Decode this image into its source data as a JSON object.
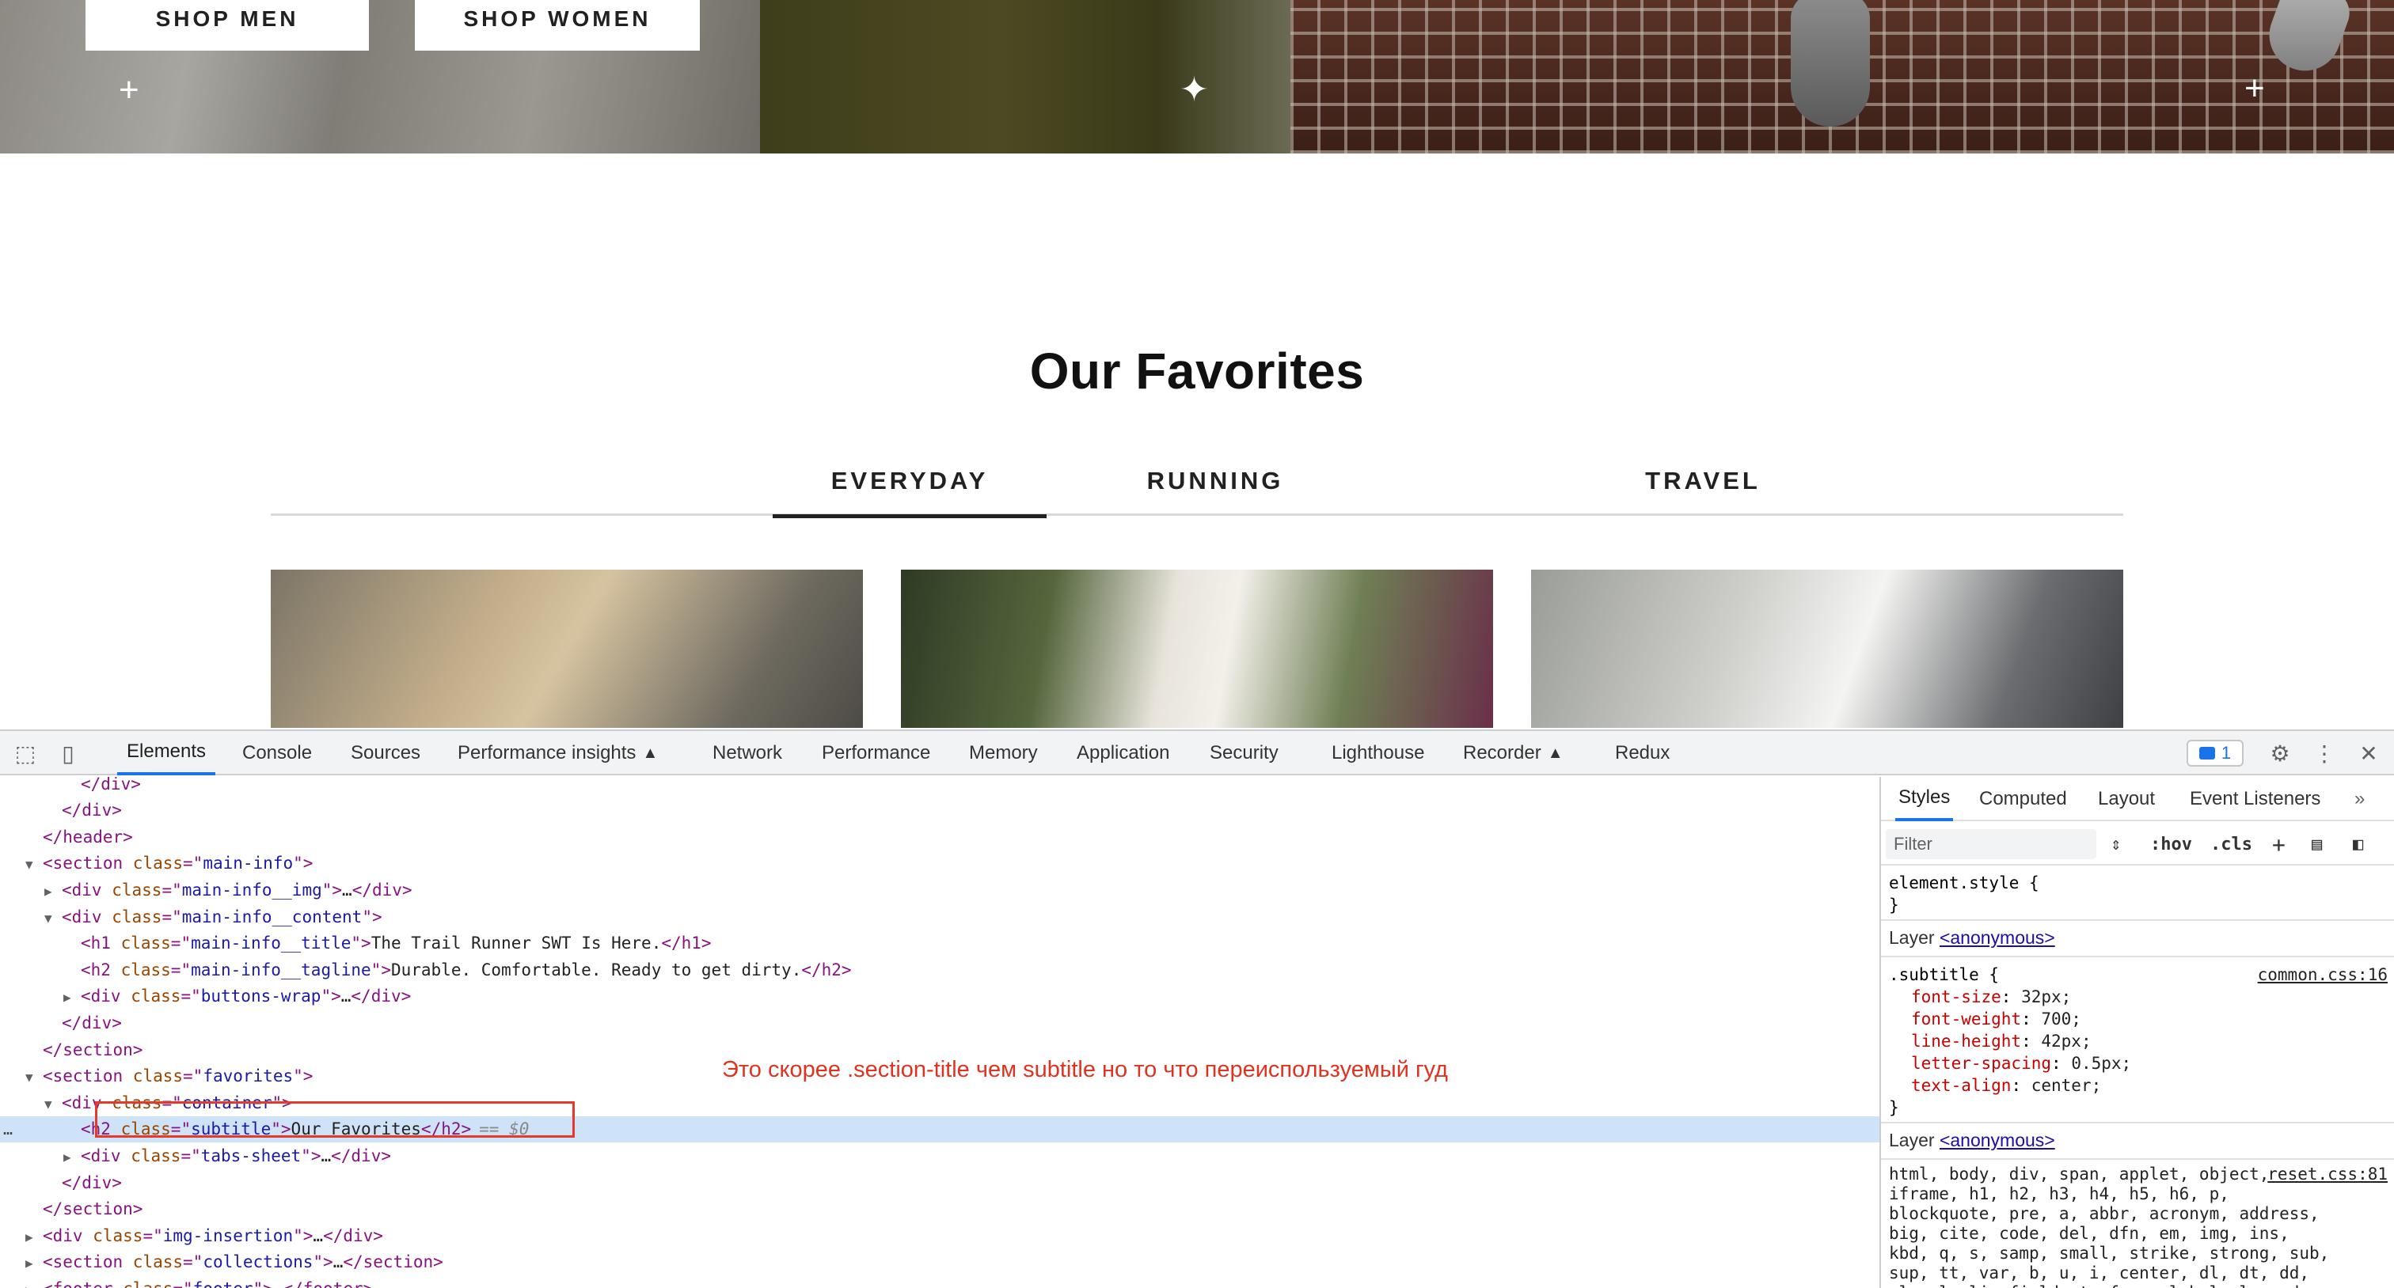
{
  "site": {
    "hero": {
      "shop_men": "SHOP MEN",
      "shop_women": "SHOP WOMEN"
    },
    "favorites": {
      "title": "Our Favorites",
      "tabs": [
        "EVERYDAY",
        "RUNNING",
        "TRAVEL"
      ],
      "active_tab": "EVERYDAY"
    }
  },
  "devtools": {
    "tabs": [
      "Elements",
      "Console",
      "Sources",
      "Performance insights",
      "Network",
      "Performance",
      "Memory",
      "Application",
      "Security",
      "Lighthouse",
      "Recorder",
      "Redux"
    ],
    "active_tab": "Elements",
    "issues_count": "1",
    "dom_lines": [
      {
        "indent": 0,
        "arrow": "",
        "parts": [
          [
            "tag",
            "</div>"
          ]
        ]
      },
      {
        "indent": 0,
        "arrow": "",
        "parts": [
          [
            "tag",
            "</div>"
          ]
        ]
      },
      {
        "indent": 0,
        "arrow": "",
        "parts": [
          [
            "tag",
            "</header>"
          ]
        ]
      },
      {
        "indent": 0,
        "arrow": "▼",
        "parts": [
          [
            "tag",
            "<section "
          ],
          [
            "attr",
            "class"
          ],
          [
            "tag",
            "=\""
          ],
          [
            "val",
            "main-info"
          ],
          [
            "tag",
            "\">"
          ]
        ]
      },
      {
        "indent": 1,
        "arrow": "▶",
        "parts": [
          [
            "tag",
            "<div "
          ],
          [
            "attr",
            "class"
          ],
          [
            "tag",
            "=\""
          ],
          [
            "val",
            "main-info__img"
          ],
          [
            "tag",
            "\">"
          ],
          [
            "txt",
            "…"
          ],
          [
            "tag",
            "</div>"
          ]
        ]
      },
      {
        "indent": 1,
        "arrow": "▼",
        "parts": [
          [
            "tag",
            "<div "
          ],
          [
            "attr",
            "class"
          ],
          [
            "tag",
            "=\""
          ],
          [
            "val",
            "main-info__content"
          ],
          [
            "tag",
            "\">"
          ]
        ]
      },
      {
        "indent": 2,
        "arrow": "",
        "parts": [
          [
            "tag",
            "<h1 "
          ],
          [
            "attr",
            "class"
          ],
          [
            "tag",
            "=\""
          ],
          [
            "val",
            "main-info__title"
          ],
          [
            "tag",
            "\">"
          ],
          [
            "txt",
            "The Trail Runner SWT Is Here."
          ],
          [
            "tag",
            "</h1>"
          ]
        ]
      },
      {
        "indent": 2,
        "arrow": "",
        "parts": [
          [
            "tag",
            "<h2 "
          ],
          [
            "attr",
            "class"
          ],
          [
            "tag",
            "=\""
          ],
          [
            "val",
            "main-info__tagline"
          ],
          [
            "tag",
            "\">"
          ],
          [
            "txt",
            "Durable. Comfortable. Ready to get dirty."
          ],
          [
            "tag",
            "</h2>"
          ]
        ]
      },
      {
        "indent": 2,
        "arrow": "▶",
        "parts": [
          [
            "tag",
            "<div "
          ],
          [
            "attr",
            "class"
          ],
          [
            "tag",
            "=\""
          ],
          [
            "val",
            "buttons-wrap"
          ],
          [
            "tag",
            "\">"
          ],
          [
            "txt",
            "…"
          ],
          [
            "tag",
            "</div>"
          ]
        ]
      },
      {
        "indent": 1,
        "arrow": "",
        "parts": [
          [
            "tag",
            "</div>"
          ]
        ]
      },
      {
        "indent": 0,
        "arrow": "",
        "parts": [
          [
            "tag",
            "</section>"
          ]
        ]
      },
      {
        "indent": 0,
        "arrow": "▼",
        "parts": [
          [
            "tag",
            "<section "
          ],
          [
            "attr",
            "class"
          ],
          [
            "tag",
            "=\""
          ],
          [
            "val",
            "favorites"
          ],
          [
            "tag",
            "\">"
          ]
        ]
      },
      {
        "indent": 1,
        "arrow": "▼",
        "parts": [
          [
            "tag",
            "<div "
          ],
          [
            "attr",
            "class"
          ],
          [
            "tag",
            "=\""
          ],
          [
            "val",
            "container"
          ],
          [
            "tag",
            "\">"
          ]
        ]
      },
      {
        "indent": 2,
        "arrow": "",
        "selected": true,
        "parts": [
          [
            "tag",
            "<h2 "
          ],
          [
            "attr",
            "class"
          ],
          [
            "tag",
            "=\""
          ],
          [
            "val",
            "subtitle"
          ],
          [
            "tag",
            "\">"
          ],
          [
            "txt",
            "Our Favorites"
          ],
          [
            "tag",
            "</h2>"
          ]
        ]
      },
      {
        "indent": 2,
        "arrow": "▶",
        "parts": [
          [
            "tag",
            "<div "
          ],
          [
            "attr",
            "class"
          ],
          [
            "tag",
            "=\""
          ],
          [
            "val",
            "tabs-sheet"
          ],
          [
            "tag",
            "\">"
          ],
          [
            "txt",
            "…"
          ],
          [
            "tag",
            "</div>"
          ]
        ]
      },
      {
        "indent": 1,
        "arrow": "",
        "parts": [
          [
            "tag",
            "</div>"
          ]
        ]
      },
      {
        "indent": 0,
        "arrow": "",
        "parts": [
          [
            "tag",
            "</section>"
          ]
        ]
      },
      {
        "indent": 0,
        "arrow": "▶",
        "parts": [
          [
            "tag",
            "<div "
          ],
          [
            "attr",
            "class"
          ],
          [
            "tag",
            "=\""
          ],
          [
            "val",
            "img-insertion"
          ],
          [
            "tag",
            "\">"
          ],
          [
            "txt",
            "…"
          ],
          [
            "tag",
            "</div>"
          ]
        ]
      },
      {
        "indent": 0,
        "arrow": "▶",
        "parts": [
          [
            "tag",
            "<section "
          ],
          [
            "attr",
            "class"
          ],
          [
            "tag",
            "=\""
          ],
          [
            "val",
            "collections"
          ],
          [
            "tag",
            "\">"
          ],
          [
            "txt",
            "…"
          ],
          [
            "tag",
            "</section>"
          ]
        ]
      },
      {
        "indent": 0,
        "arrow": "▶",
        "parts": [
          [
            "tag",
            "<footer "
          ],
          [
            "attr",
            "class"
          ],
          [
            "tag",
            "=\""
          ],
          [
            "val",
            "footer"
          ],
          [
            "tag",
            "\">"
          ],
          [
            "txt",
            "…"
          ],
          [
            "tag",
            "</footer>"
          ]
        ]
      }
    ],
    "selected_marker": "== $0",
    "gutter_dots": "…",
    "annotation": "Это скорее .section-title чем subtitle но то что переиспользуемый гуд",
    "styles_panel": {
      "tabs": [
        "Styles",
        "Computed",
        "Layout",
        "Event Listeners"
      ],
      "active_tab": "Styles",
      "filter_placeholder": "Filter",
      "hov": ":hov",
      "cls": ".cls",
      "element_style_open": "element.style {",
      "close_brace": "}",
      "layer_label": "Layer",
      "layer_link": "<anonymous>",
      "rule1": {
        "selector": ".subtitle {",
        "source": "common.css:16",
        "props": [
          {
            "name": "font-size",
            "value": "32px;"
          },
          {
            "name": "font-weight",
            "value": "700;"
          },
          {
            "name": "line-height",
            "value": "42px;"
          },
          {
            "name": "letter-spacing",
            "value": "0.5px;"
          },
          {
            "name": "text-align",
            "value": "center;"
          }
        ]
      },
      "rule2": {
        "source": "reset.css:81",
        "selectors": "html, body, div, span, applet, object, iframe, h1, h2, h3, h4, h5, h6, p, blockquote, pre, a, abbr, acronym, address, big, cite, code, del, dfn, em, img, ins, kbd, q, s, samp, small, strike, strong, sub, sup, tt, var, b, u, i, center, dl, dt, dd, ol, ul, li, fieldset, form, label, legend,"
      }
    }
  }
}
